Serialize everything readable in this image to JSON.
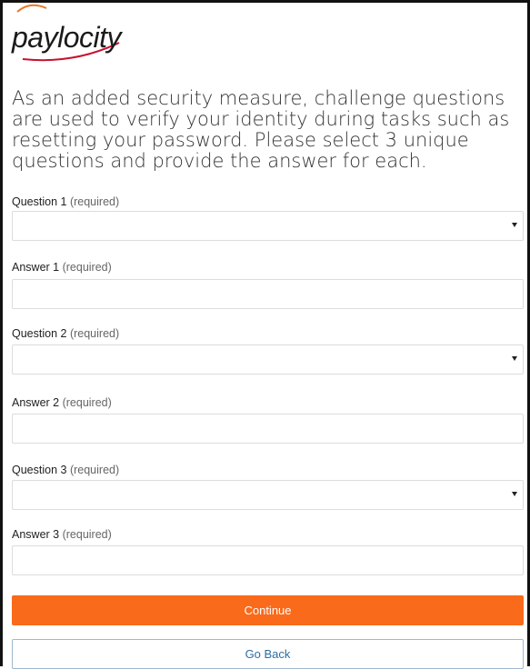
{
  "brand": {
    "logo_text": "paylocity",
    "accent": "#f96a1b",
    "swoosh_color": "#c8102e"
  },
  "intro": "As an added security measure, challenge questions are used to verify your identity during tasks such as resetting your password. Please select 3 unique questions and provide the answer for each.",
  "fields": {
    "q1_label": "Question 1",
    "a1_label": "Answer 1",
    "q2_label": "Question 2",
    "a2_label": "Answer 2",
    "q3_label": "Question 3",
    "a3_label": "Answer 3",
    "required": "(required)"
  },
  "buttons": {
    "continue": "Continue",
    "back": "Go Back"
  },
  "icons": {
    "select_arrow": "triangle-down-icon"
  }
}
